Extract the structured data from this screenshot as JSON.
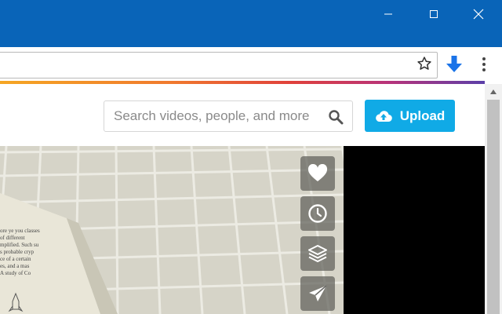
{
  "window": {
    "minimize_icon": "minimize-icon",
    "maximize_icon": "maximize-icon",
    "close_icon": "close-icon"
  },
  "toolbar": {
    "address_value": "",
    "bookmark_icon": "star-icon",
    "download_icon": "download-arrow-icon",
    "menu_icon": "kebab-menu-icon"
  },
  "header": {
    "search": {
      "placeholder": "Search videos, people, and more",
      "value": "",
      "icon": "search-icon"
    },
    "upload_label": "Upload",
    "upload_icon": "cloud-upload-icon"
  },
  "video": {
    "actions": [
      {
        "name": "like",
        "icon": "heart-icon"
      },
      {
        "name": "watch-later",
        "icon": "clock-icon"
      },
      {
        "name": "collections",
        "icon": "layers-icon"
      },
      {
        "name": "share",
        "icon": "paper-plane-icon"
      }
    ],
    "book_text": [
      "ore ye you classes",
      "of different",
      "mplified. Such su",
      "s probable cryp",
      "ce of a certain",
      "es, and a mas",
      "A study of Co"
    ]
  },
  "colors": {
    "titlebar": "#0964b8",
    "upload_button": "#10aae6",
    "download_arrow": "#1a73e8"
  }
}
